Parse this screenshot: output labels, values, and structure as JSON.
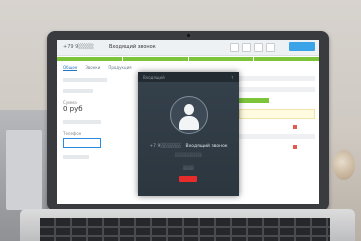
{
  "header": {
    "record_number": "+79 9░░░░",
    "title": "Входящий звонок"
  },
  "tabs": [
    "Общее",
    "Звонки",
    "Продукция"
  ],
  "form": {
    "amount_label": "Сумма",
    "amount_value": "0 руб",
    "phone_label": "Телефон"
  },
  "call": {
    "header_left": "Входящий",
    "header_right": "↑",
    "caller_number": "+7 9░░░░░░",
    "call_type": "Входящий звонок",
    "caller_sub": "░░░░░░░░░░",
    "status": "░░░░",
    "hangup_color": "#e82b2b"
  },
  "colors": {
    "accent": "#3ba4e8",
    "progress": "#7cc43a",
    "popup_bg": "#2c363f"
  }
}
